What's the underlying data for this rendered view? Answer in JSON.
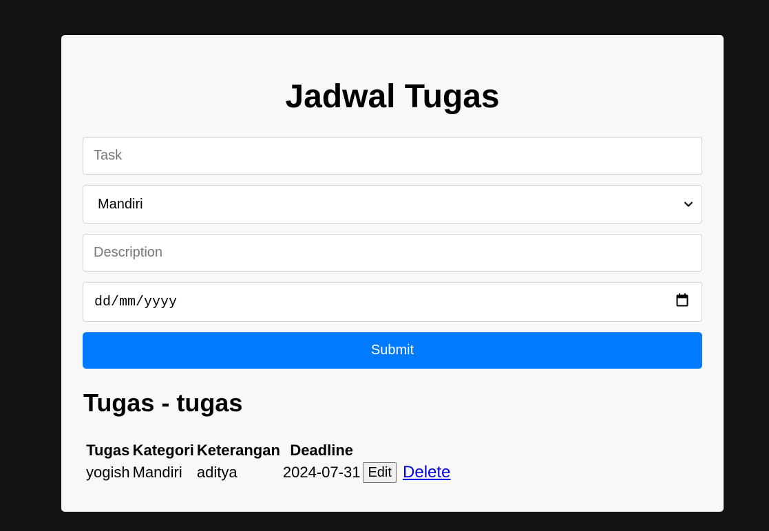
{
  "header": {
    "title": "Jadwal Tugas"
  },
  "form": {
    "task_placeholder": "Task",
    "category_value": "Mandiri",
    "description_placeholder": "Description",
    "date_placeholder": "dd/mm/yyyy",
    "submit_label": "Submit"
  },
  "list": {
    "title": "Tugas - tugas",
    "columns": [
      "Tugas",
      "Kategori",
      "Keterangan",
      "Deadline"
    ],
    "rows": [
      {
        "tugas": "yogish",
        "kategori": "Mandiri",
        "keterangan": "aditya",
        "deadline": "2024-07-31",
        "edit_label": "Edit",
        "delete_label": "Delete"
      }
    ]
  },
  "icons": {
    "select": "chevron-down-icon",
    "date": "calendar-icon"
  },
  "colors": {
    "background": "#121212",
    "card": "#f8f8f8",
    "accent": "#007bff",
    "link": "#0000ee"
  }
}
